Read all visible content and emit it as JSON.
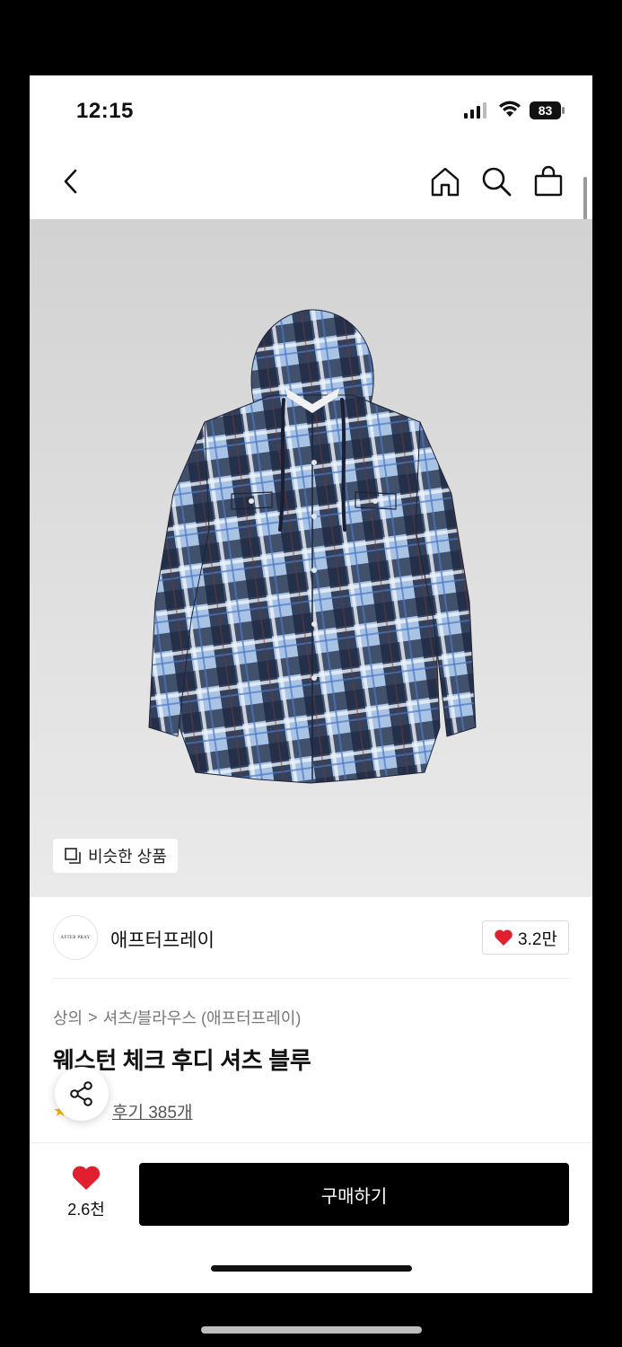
{
  "status": {
    "time": "12:15",
    "battery": "83"
  },
  "nav": {
    "back_icon": "chevron-left-icon",
    "home_icon": "home-icon",
    "search_icon": "search-icon",
    "cart_icon": "shopping-bag-icon"
  },
  "product": {
    "similar_label": "비슷한 상품",
    "brand_logo_text": "AFTER PRAY",
    "brand_name": "애프터프레이",
    "brand_likes": "3.2만",
    "breadcrumb": {
      "category": "상의",
      "separator": ">",
      "subcategory": "셔츠/블라우스 (애프터프레이)"
    },
    "title": "웨스턴 체크 후디 셔츠 블루",
    "reviews": "후기 385개"
  },
  "bottom": {
    "likes": "2.6천",
    "buy_label": "구매하기"
  },
  "colors": {
    "accent": "#e0202e",
    "buy_bg": "#000000",
    "star": "#f6b400"
  }
}
